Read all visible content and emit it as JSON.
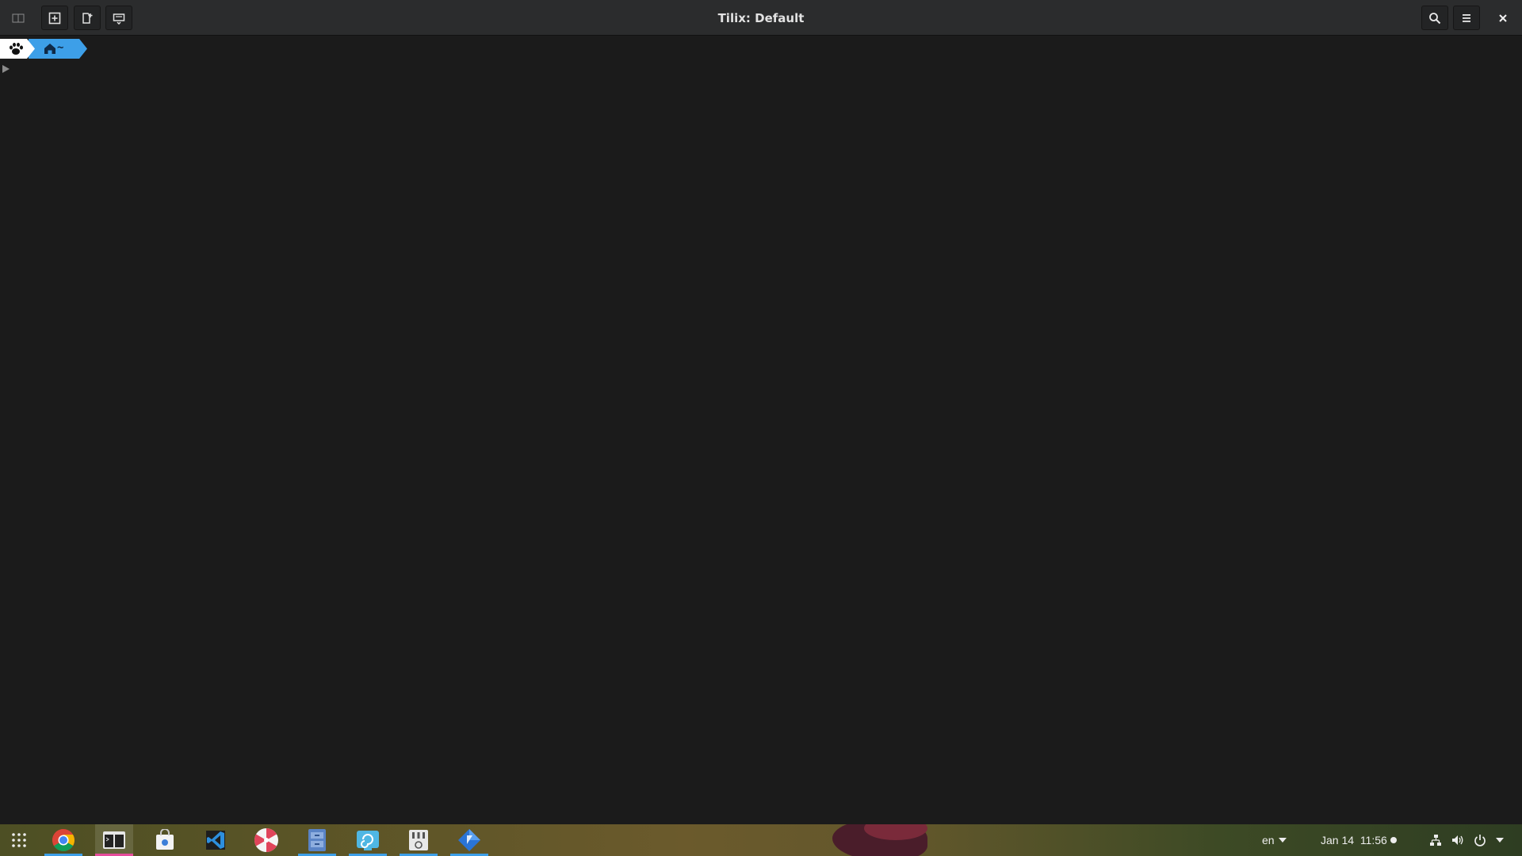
{
  "window": {
    "title": "Tilix: Default"
  },
  "headerbar": {
    "buttons": [
      {
        "name": "sidebar-toggle-button",
        "icon": "sidebar-icon"
      },
      {
        "name": "add-terminal-right-button",
        "icon": "add-terminal-icon"
      },
      {
        "name": "add-terminal-down-button",
        "icon": "split-down-icon"
      },
      {
        "name": "session-actions-button",
        "icon": "session-icon"
      }
    ],
    "right_buttons": [
      {
        "name": "find-button",
        "icon": "search-icon"
      },
      {
        "name": "menu-button",
        "icon": "hamburger-menu-icon"
      },
      {
        "name": "close-button",
        "icon": "close-icon"
      }
    ]
  },
  "terminal": {
    "prompt_os_icon": "paw-icon",
    "prompt_dir_icon": "home-icon",
    "prompt_dir": "~",
    "prompt_colors": {
      "os_bg": "#ffffff",
      "dir_bg": "#3d9fe8"
    }
  },
  "taskbar": {
    "apps": [
      {
        "name": "app-grid",
        "icon": "app-grid-icon"
      },
      {
        "name": "chrome",
        "icon": "chrome-icon"
      },
      {
        "name": "tilix",
        "icon": "terminal-icon",
        "active": true
      },
      {
        "name": "software-store",
        "icon": "store-bag-icon"
      },
      {
        "name": "vscode",
        "icon": "vscode-icon"
      },
      {
        "name": "peppermint",
        "icon": "candy-icon"
      },
      {
        "name": "files",
        "icon": "file-cabinet-icon"
      },
      {
        "name": "screenshot",
        "icon": "swirl-icon"
      },
      {
        "name": "mixer",
        "icon": "mixer-icon"
      },
      {
        "name": "flutter",
        "icon": "diamond-icon"
      }
    ],
    "keyboard_layout": "en",
    "clock": "Jan 14  11:56",
    "colors": {
      "active_indicator": "#e64c9c",
      "running_indicator": "#3d9fe8"
    }
  }
}
